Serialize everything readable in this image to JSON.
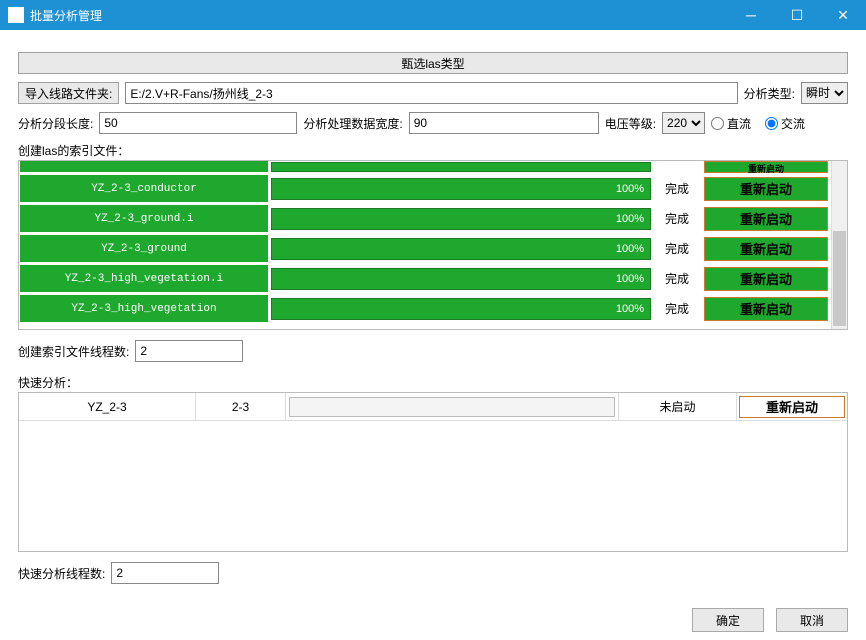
{
  "window": {
    "title": "批量分析管理"
  },
  "top_button": "甄选las类型",
  "import": {
    "button": "导入线路文件夹:",
    "path": "E:/2.V+R-Fans/扬州线_2-3"
  },
  "analysis_type": {
    "label": "分析类型:",
    "value": "瞬时"
  },
  "seg_len": {
    "label": "分析分段长度:",
    "value": "50"
  },
  "data_width": {
    "label": "分析处理数据宽度:",
    "value": "90"
  },
  "voltage": {
    "label": "电压等级:",
    "value": "220"
  },
  "current": {
    "dc": "直流",
    "ac": "交流",
    "selected": "ac"
  },
  "index_section": {
    "label": "创建las的索引文件：",
    "partial": {
      "action": "重新启动"
    },
    "rows": [
      {
        "name": "YZ_2-3_conductor",
        "pct": "100%",
        "status": "完成",
        "action": "重新启动"
      },
      {
        "name": "YZ_2-3_ground.i",
        "pct": "100%",
        "status": "完成",
        "action": "重新启动"
      },
      {
        "name": "YZ_2-3_ground",
        "pct": "100%",
        "status": "完成",
        "action": "重新启动"
      },
      {
        "name": "YZ_2-3_high_vegetation.i",
        "pct": "100%",
        "status": "完成",
        "action": "重新启动"
      },
      {
        "name": "YZ_2-3_high_vegetation",
        "pct": "100%",
        "status": "完成",
        "action": "重新启动"
      }
    ]
  },
  "index_threads": {
    "label": "创建索引文件线程数:",
    "value": "2"
  },
  "fast_section": {
    "label": "快速分析：",
    "rows": [
      {
        "c1": "YZ_2-3",
        "c2": "2-3",
        "status": "未启动",
        "action": "重新启动"
      }
    ]
  },
  "fast_threads": {
    "label": "快速分析线程数:",
    "value": "2"
  },
  "footer": {
    "ok": "确定",
    "cancel": "取消"
  }
}
